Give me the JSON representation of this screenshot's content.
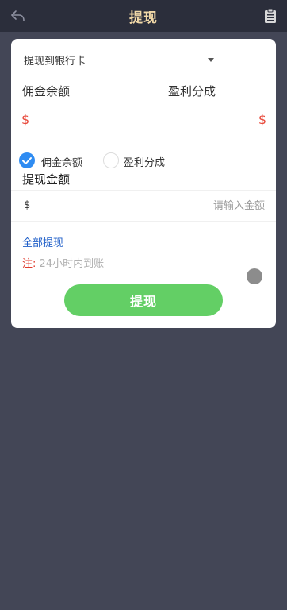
{
  "header": {
    "title": "提现",
    "back_icon": "back-arrow-icon",
    "right_icon": "clipboard-icon",
    "title_color": "#f2d9a8"
  },
  "bank": {
    "label": "提现到银行卡",
    "dropdown_icon": "caret-down-icon"
  },
  "balances": {
    "commission_label": "佣金余额",
    "profit_label": "盈利分成",
    "commission_currency": "$",
    "profit_currency": "$"
  },
  "source_options": [
    {
      "label": "佣金余额",
      "checked": true
    },
    {
      "label": "盈利分成",
      "checked": false
    }
  ],
  "amount": {
    "title": "提现金额",
    "currency": "$",
    "placeholder": "请输入金额"
  },
  "withdraw_all": "全部提现",
  "note": {
    "label": "注:",
    "text": "24小时内到账"
  },
  "submit_label": "提现",
  "colors": {
    "background": "#434656",
    "header": "#2b2e3b",
    "accent_red": "#e84a3c",
    "link_blue": "#1e5ec8",
    "button_green": "#63cf65",
    "radio_blue": "#2f8cf2"
  }
}
